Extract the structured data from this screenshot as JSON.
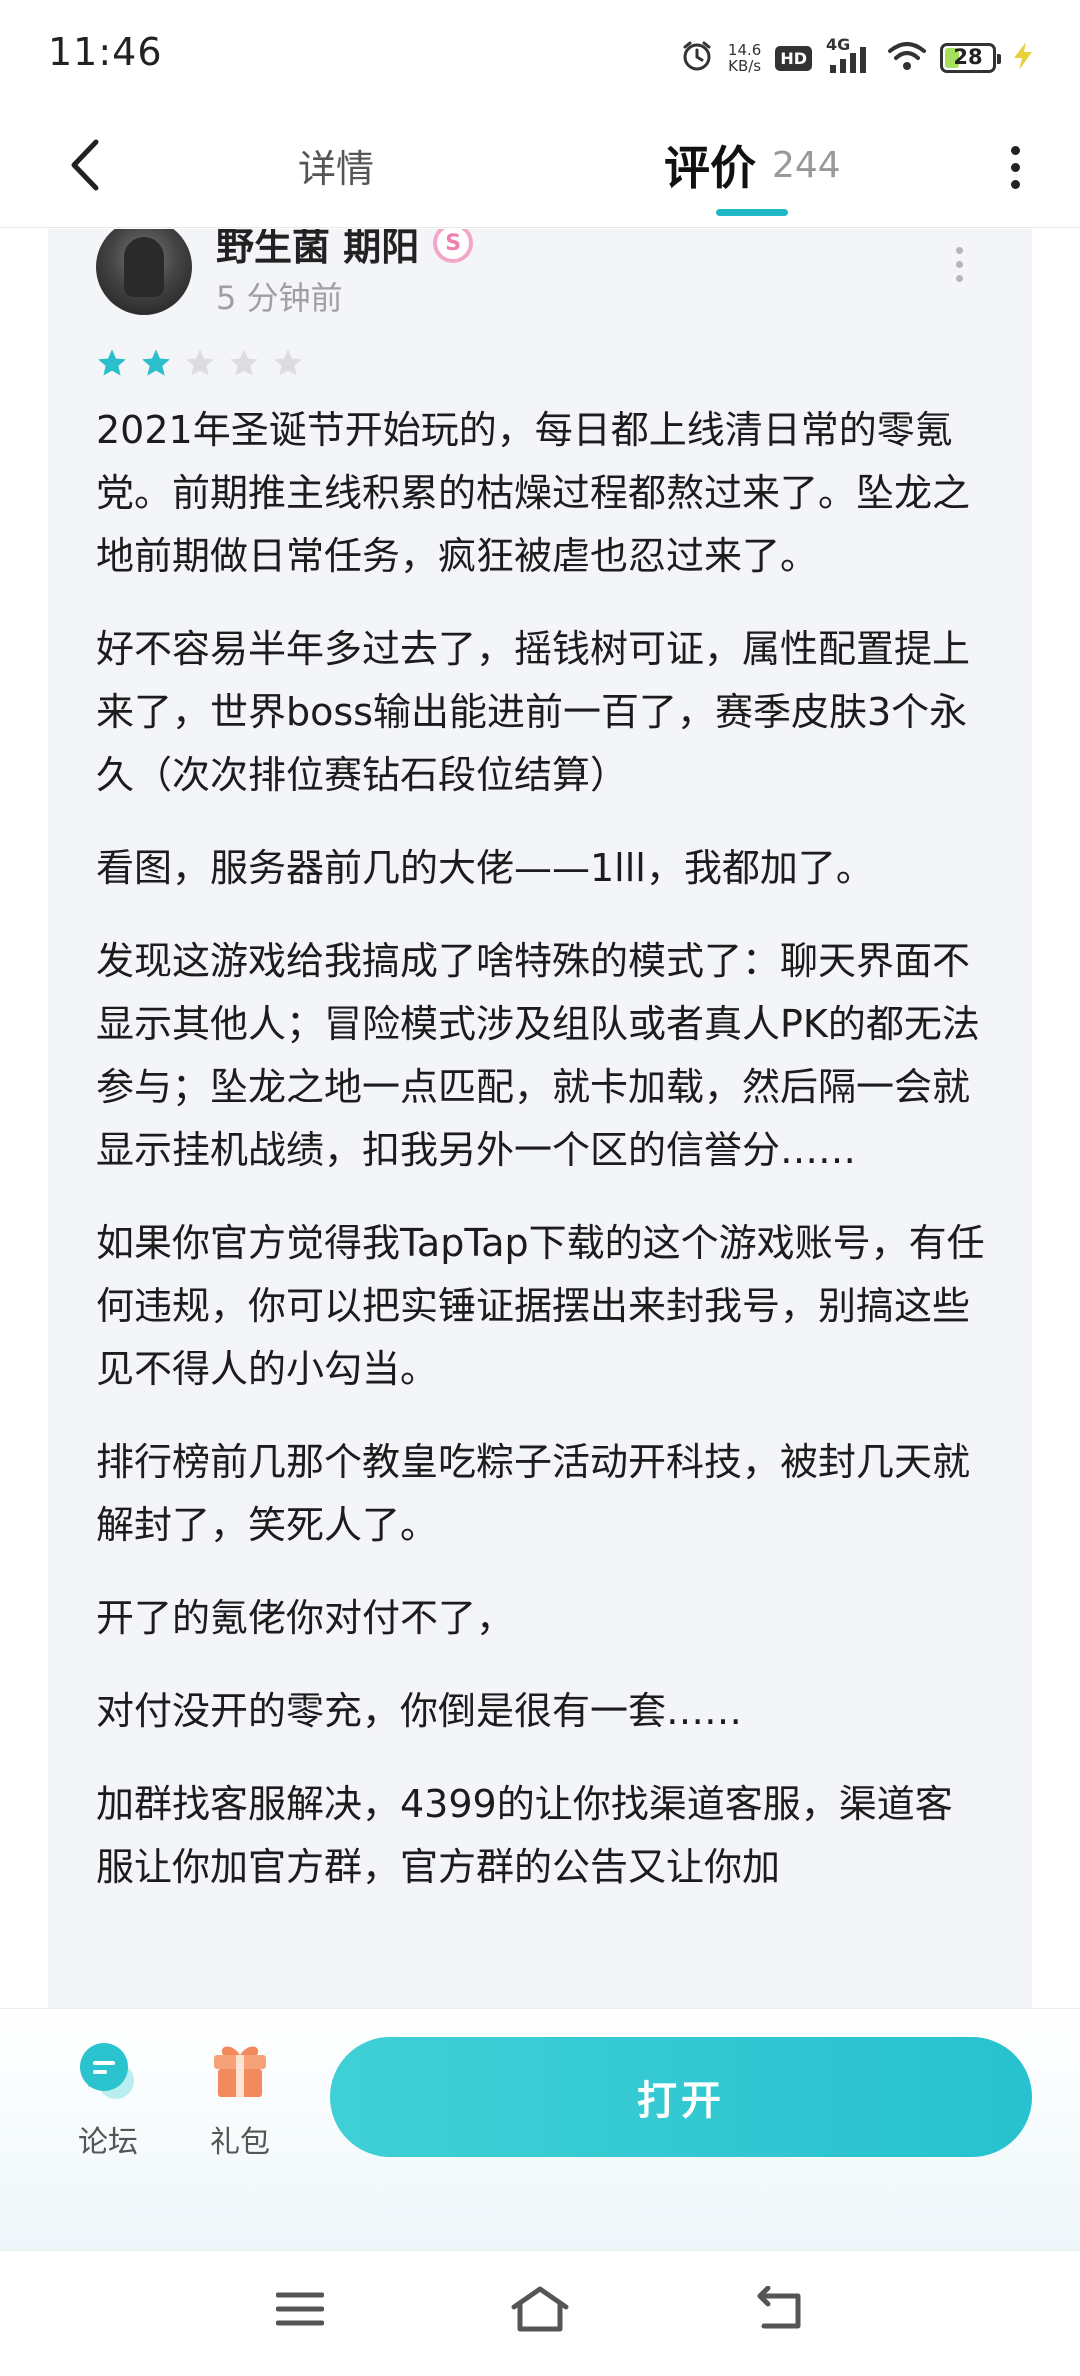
{
  "status_bar": {
    "time": "11:46",
    "net_speed_value": "14.6",
    "net_speed_unit": "KB/s",
    "hd": "HD",
    "signal": "4G",
    "battery": "28"
  },
  "header": {
    "tab_details": "详情",
    "tab_reviews": "评价",
    "review_count": "244"
  },
  "review": {
    "username": "野生菌 期阳",
    "badge": "S",
    "time": "5 分钟前",
    "rating": 2,
    "max_rating": 5,
    "paragraphs": [
      "2021年圣诞节开始玩的，每日都上线清日常的零氪党。前期推主线积累的枯燥过程都熬过来了。坠龙之地前期做日常任务，疯狂被虐也忍过来了。",
      "好不容易半年多过去了，摇钱树可证，属性配置提上来了，世界boss输出能进前一百了，赛季皮肤3个永久（次次排位赛钻石段位结算）",
      "看图，服务器前几的大佬——1lll，我都加了。",
      "发现这游戏给我搞成了啥特殊的模式了：聊天界面不显示其他人；冒险模式涉及组队或者真人PK的都无法参与；坠龙之地一点匹配，就卡加载，然后隔一会就显示挂机战绩，扣我另外一个区的信誉分……",
      "如果你官方觉得我TapTap下载的这个游戏账号，有任何违规，你可以把实锤证据摆出来封我号，别搞这些见不得人的小勾当。",
      "排行榜前几那个教皇吃粽子活动开科技，被封几天就解封了，笑死人了。",
      "开了的氪佬你对付不了，",
      "对付没开的零充，你倒是很有一套……",
      "加群找客服解决，4399的让你找渠道客服，渠道客服让你加官方群，官方群的公告又让你加"
    ]
  },
  "actions": {
    "forum_label": "论坛",
    "gift_label": "礼包",
    "open_label": "打开"
  },
  "colors": {
    "accent": "#1fb9c6",
    "star_filled": "#2bbecb",
    "star_empty": "#dcdde2",
    "card_bg": "#f4f5f9"
  }
}
